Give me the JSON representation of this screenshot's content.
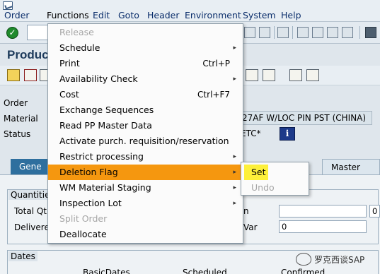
{
  "menubar": {
    "items": [
      "Order",
      "Functions",
      "Edit",
      "Goto",
      "Header",
      "Environment",
      "System",
      "Help"
    ]
  },
  "toolbar": {
    "enter_icon": "check-icon",
    "command_field": ""
  },
  "page": {
    "title": "Produc"
  },
  "header": {
    "order_label": "Order",
    "material_label": "Material",
    "material_value": "27AF W/LOC PIN PST (CHINA)",
    "status_label": "Status",
    "status_value": "ETC*",
    "info_button_label": "i"
  },
  "tabs": [
    {
      "label": "Gene"
    },
    {
      "label": "Master Data"
    }
  ],
  "quantities": {
    "title": "Quantitie",
    "total_label": "Total Qt",
    "delivered_label": "Delivered",
    "right_label_1": "n",
    "right_label_2": "Var",
    "input_1": "",
    "input_1b": "0",
    "input_2": "0"
  },
  "dates": {
    "title": "Dates",
    "col_basic": "BasicDates",
    "col_scheduled": "Scheduled",
    "col_confirmed": "Confirmed"
  },
  "functions_menu": {
    "items": [
      {
        "label": "Release",
        "disabled": true,
        "shortcut": "",
        "submenu": false
      },
      {
        "label": "Schedule",
        "disabled": false,
        "shortcut": "",
        "submenu": true
      },
      {
        "label": "Print",
        "disabled": false,
        "shortcut": "Ctrl+P",
        "submenu": false
      },
      {
        "label": "Availability Check",
        "disabled": false,
        "shortcut": "",
        "submenu": true
      },
      {
        "label": "Cost",
        "disabled": false,
        "shortcut": "Ctrl+F7",
        "submenu": false
      },
      {
        "label": "Exchange Sequences",
        "disabled": false,
        "shortcut": "",
        "submenu": false
      },
      {
        "label": "Read PP Master Data",
        "disabled": false,
        "shortcut": "",
        "submenu": false
      },
      {
        "label": "Activate purch. requisition/reservation",
        "disabled": false,
        "shortcut": "",
        "submenu": false
      },
      {
        "label": "Restrict processing",
        "disabled": false,
        "shortcut": "",
        "submenu": true
      },
      {
        "label": "Deletion Flag",
        "disabled": false,
        "shortcut": "",
        "submenu": true,
        "highlighted": true
      },
      {
        "label": "WM Material Staging",
        "disabled": false,
        "shortcut": "",
        "submenu": true
      },
      {
        "label": "Inspection Lot",
        "disabled": false,
        "shortcut": "",
        "submenu": true
      },
      {
        "label": "Split Order",
        "disabled": true,
        "shortcut": "",
        "submenu": false
      },
      {
        "label": "Deallocate",
        "disabled": false,
        "shortcut": "",
        "submenu": false
      }
    ]
  },
  "deletion_flag_submenu": {
    "set_label": "Set",
    "undo_label": "Undo"
  },
  "watermark": {
    "text": "罗克西谈SAP"
  },
  "colors": {
    "menu_highlight": "#f5970f",
    "submenu_highlight": "#fdf03a",
    "tab_active": "#2e6f9e"
  }
}
